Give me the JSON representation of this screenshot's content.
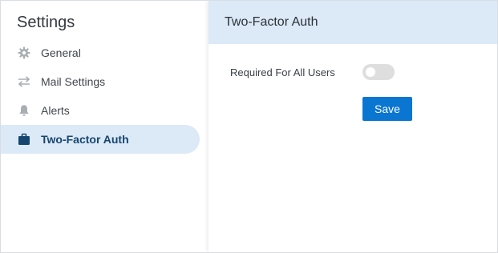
{
  "sidebar": {
    "title": "Settings",
    "items": [
      {
        "label": "General",
        "icon": "gear-icon",
        "active": false
      },
      {
        "label": "Mail Settings",
        "icon": "arrows-exchange-icon",
        "active": false
      },
      {
        "label": "Alerts",
        "icon": "bell-icon",
        "active": false
      },
      {
        "label": "Two-Factor Auth",
        "icon": "briefcase-icon",
        "active": true
      }
    ]
  },
  "main": {
    "title": "Two-Factor Auth",
    "required_label": "Required For All Users",
    "required_toggle_on": false,
    "save_label": "Save"
  },
  "colors": {
    "accent": "#0a76d1",
    "active_bg": "#dce9f7",
    "active_text": "#16466f",
    "icon_gray": "#a9aeb3"
  }
}
